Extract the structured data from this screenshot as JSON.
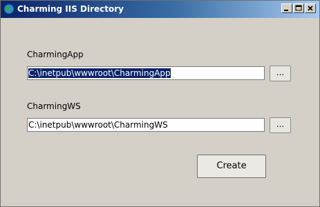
{
  "window": {
    "title": "Charming IIS Directory",
    "icon": "app-globe-icon",
    "controls": {
      "minimize": "_",
      "maximize": "□",
      "close": "×"
    }
  },
  "form": {
    "app": {
      "label": "CharmingApp",
      "value": "C:\\inetpub\\wwwroot\\CharmingApp",
      "value_selected": true,
      "browse_label": "..."
    },
    "ws": {
      "label": "CharmingWS",
      "value": "C:\\inetpub\\wwwroot\\CharmingWS",
      "browse_label": "..."
    },
    "create_label": "Create"
  },
  "colors": {
    "titlebar_start": "#0a246a",
    "titlebar_end": "#a6caf0",
    "selection": "#0a246a",
    "dialog_bg": "#d4d0c8"
  }
}
